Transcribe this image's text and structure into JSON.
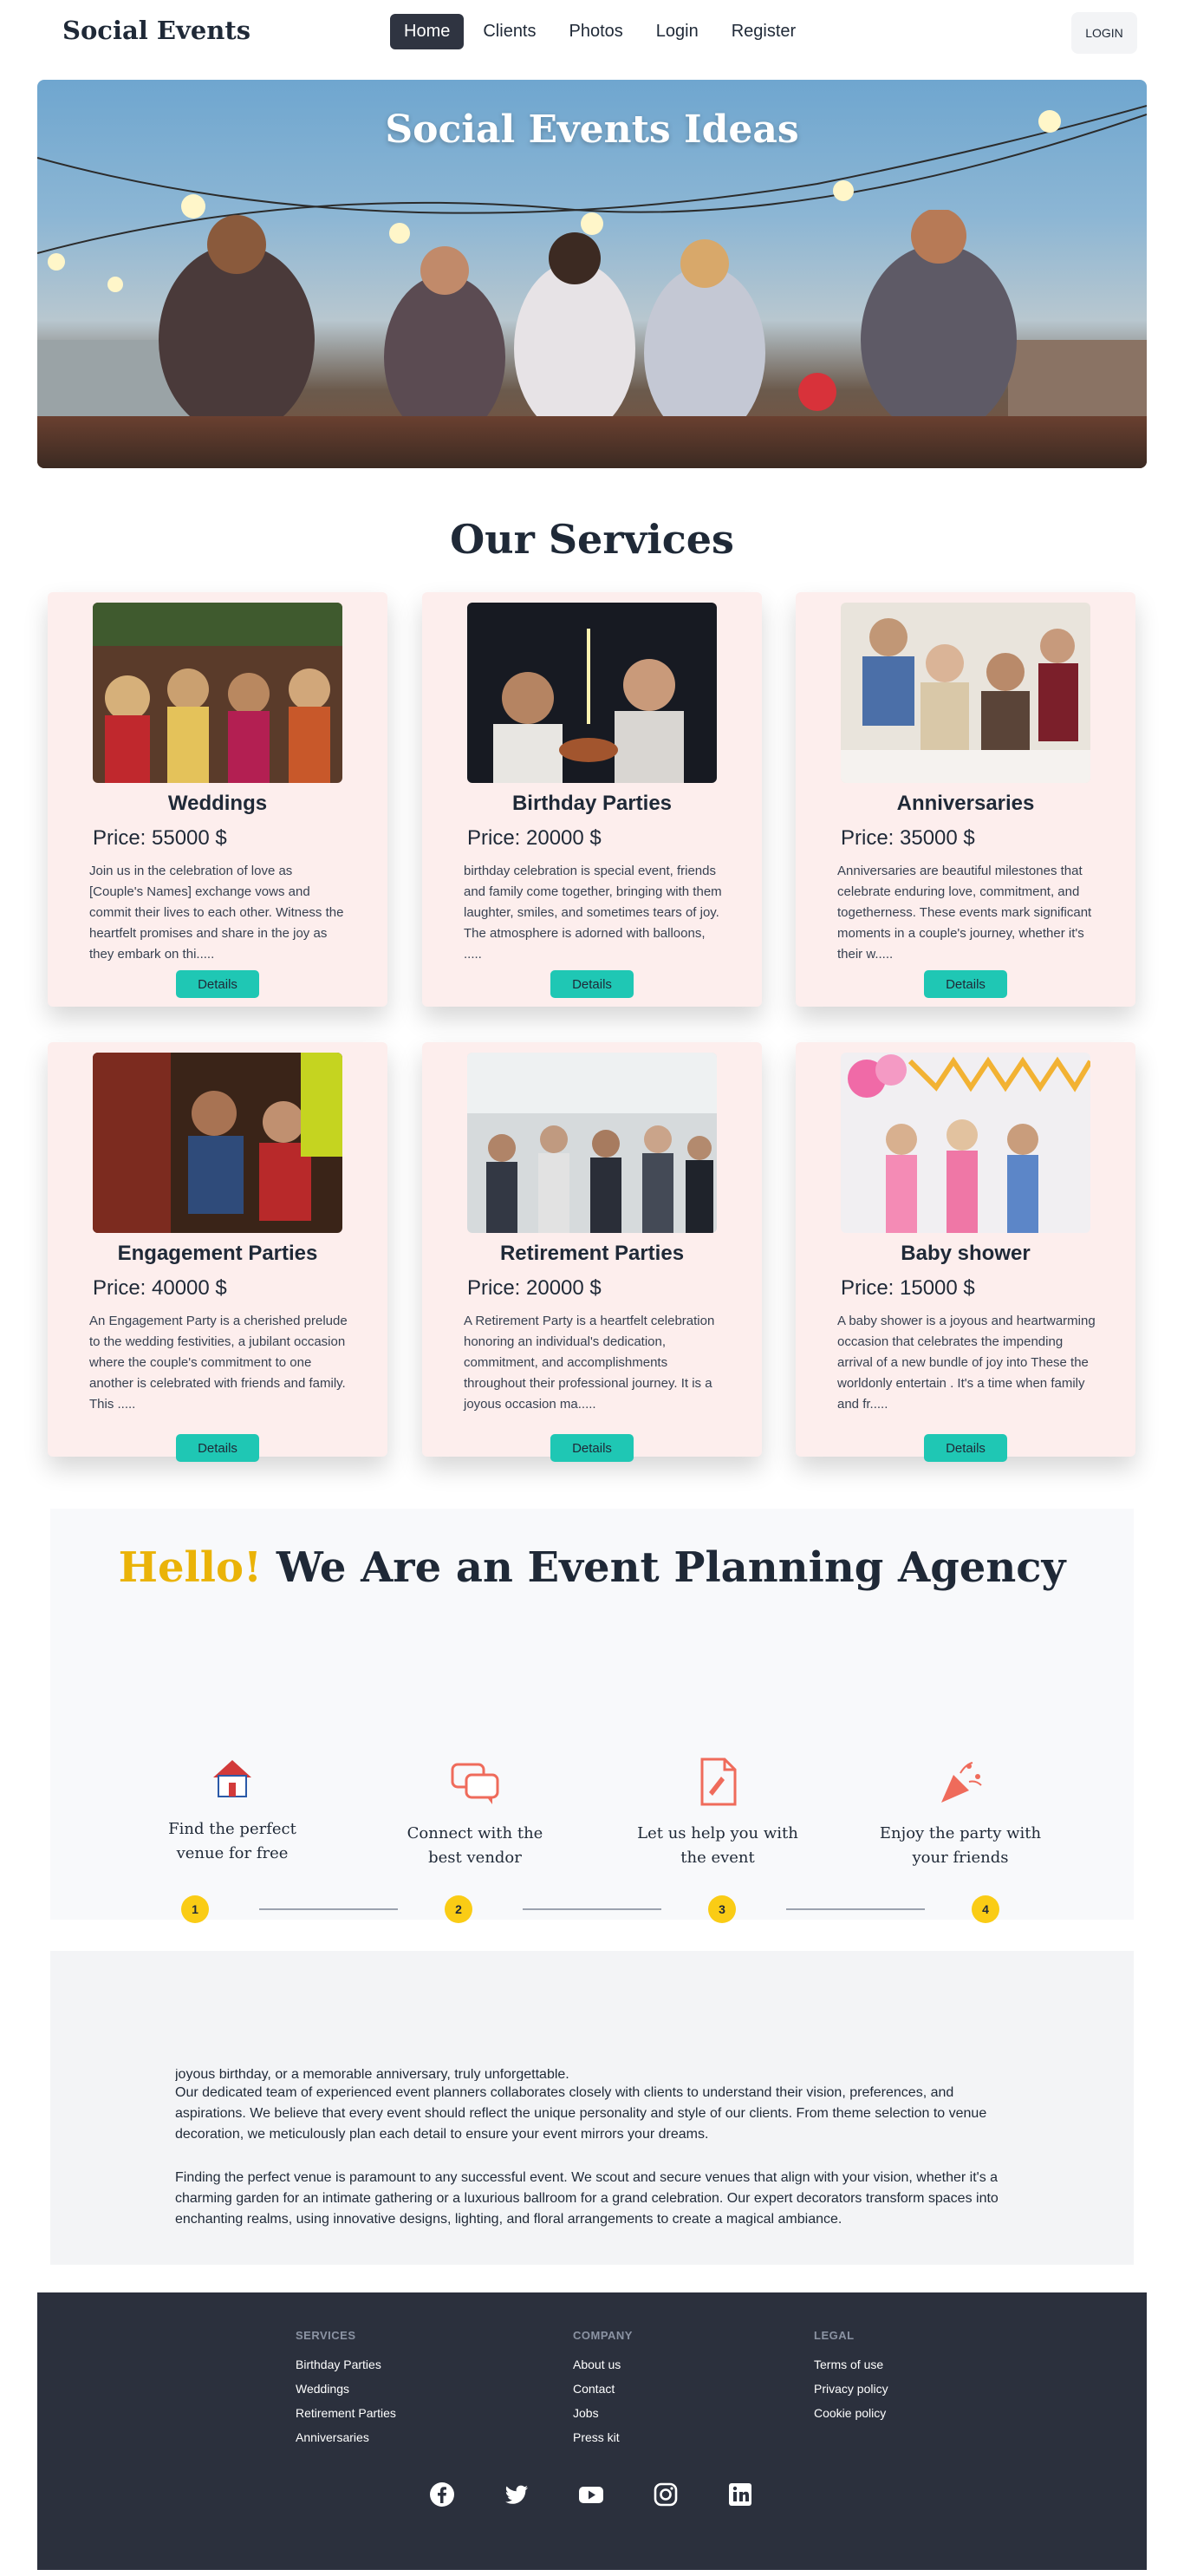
{
  "nav": {
    "brand": "Social Events",
    "links": [
      "Home",
      "Clients",
      "Photos",
      "Login",
      "Register"
    ],
    "active": "Home",
    "login_button": "LOGIN"
  },
  "hero": {
    "title": "Social Events Ideas"
  },
  "services": {
    "title": "Our Services",
    "cards": [
      {
        "title": "Weddings",
        "price": "Price: 55000 $",
        "desc": "Join us in the celebration of love as [Couple's Names] exchange vows and commit their lives to each other. Witness the heartfelt promises and share in the joy as they embark on thi.....",
        "button": "Details"
      },
      {
        "title": "Birthday Parties",
        "price": "Price: 20000 $",
        "desc": "birthday celebration is special event, friends and family come together, bringing with them laughter, smiles, and sometimes tears of joy. The atmosphere is adorned with balloons, .....",
        "button": "Details"
      },
      {
        "title": "Anniversaries",
        "price": "Price: 35000 $",
        "desc": "Anniversaries are beautiful milestones that celebrate enduring love, commitment, and togetherness. These events mark significant moments in a couple's journey, whether it's their w.....",
        "button": "Details"
      },
      {
        "title": "Engagement Parties",
        "price": "Price: 40000 $",
        "desc": "An Engagement Party is a cherished prelude to the wedding festivities, a jubilant occasion where the couple's commitment to one another is celebrated with friends and family. This .....",
        "button": "Details"
      },
      {
        "title": "Retirement Parties",
        "price": "Price: 20000 $",
        "desc": "A Retirement Party is a heartfelt celebration honoring an individual's dedication, commitment, and accomplishments throughout their professional journey. It is a joyous occasion ma.....",
        "button": "Details"
      },
      {
        "title": "Baby shower",
        "price": "Price: 15000 $",
        "desc": "A baby shower is a joyous and heartwarming occasion that celebrates the impending arrival of a new bundle of joy into These the worldonly entertain . It's a time when family and fr.....",
        "button": "Details"
      }
    ]
  },
  "agency": {
    "hello": "Hello!",
    "title_rest": " We Are an Event Planning Agency",
    "steps": [
      {
        "num": "1",
        "label": "Find the perfect venue for free",
        "icon": "house-icon"
      },
      {
        "num": "2",
        "label": "Connect with the best vendor",
        "icon": "chat-bubbles-icon"
      },
      {
        "num": "3",
        "label": "Let us help you with the event",
        "icon": "document-edit-icon"
      },
      {
        "num": "4",
        "label": "Enjoy the party with your friends",
        "icon": "party-popper-icon"
      }
    ]
  },
  "about": {
    "partial_line": "joyous birthday, or a memorable anniversary, truly unforgettable.",
    "para1": "Our dedicated team of experienced event planners collaborates closely with clients to understand their vision, preferences, and aspirations. We believe that every event should reflect the unique personality and style of our clients. From theme selection to venue decoration, we meticulously plan each detail to ensure your event mirrors your dreams.",
    "para2": "Finding the perfect venue is paramount to any successful event. We scout and secure venues that align with your vision, whether it's a charming garden for an intimate gathering or a luxurious ballroom for a grand celebration. Our expert decorators transform spaces into enchanting realms, using innovative designs, lighting, and floral arrangements to create a magical ambiance."
  },
  "footer": {
    "columns": [
      {
        "head": "SERVICES",
        "links": [
          "Birthday Parties",
          "Weddings",
          "Retirement Parties",
          "Anniversaries"
        ]
      },
      {
        "head": "COMPANY",
        "links": [
          "About us",
          "Contact",
          "Jobs",
          "Press kit"
        ]
      },
      {
        "head": "LEGAL",
        "links": [
          "Terms of use",
          "Privacy policy",
          "Cookie policy"
        ]
      }
    ],
    "social": [
      "facebook-icon",
      "twitter-icon",
      "youtube-icon",
      "instagram-icon",
      "linkedin-icon"
    ]
  },
  "colors": {
    "accent_teal": "#1fc7b4",
    "accent_yellow": "#eab308",
    "card_bg": "#fdeeed",
    "nav_active": "#2f3441",
    "footer_bg": "#2b303d",
    "icon_red": "#ef6b5b"
  }
}
